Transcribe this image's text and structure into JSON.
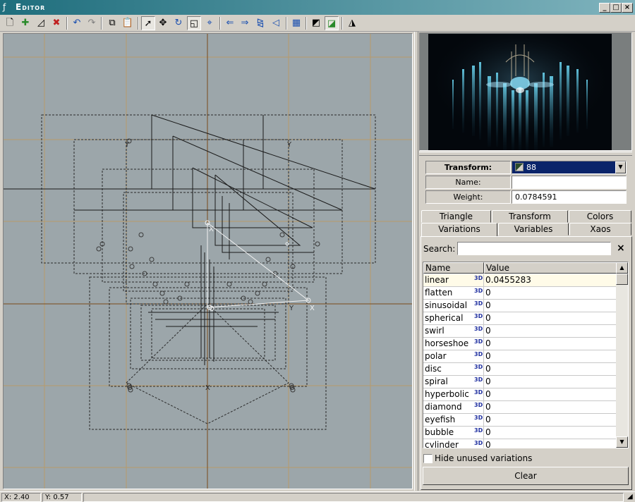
{
  "titlebar": {
    "title": "Editor",
    "minimize": "_",
    "maximize": "□",
    "close": "×"
  },
  "toolbar": {
    "icons": [
      "new-icon",
      "add-icon",
      "duplicate-icon",
      "delete-icon",
      "undo-icon",
      "redo-icon",
      "copy-icon",
      "paste-icon",
      "select-icon",
      "move-icon",
      "rotate-icon",
      "scale-icon",
      "pivot-icon",
      "rotate-left-icon",
      "rotate-right-icon",
      "flip-horizontal-icon",
      "flip-vertical-icon",
      "grid-icon",
      "toggle-variations-icon",
      "toggle-final-icon",
      "settings-icon"
    ]
  },
  "properties": {
    "transform_label": "Transform:",
    "transform_value": "88",
    "name_label": "Name:",
    "name_value": "",
    "weight_label": "Weight:",
    "weight_value": "0.0784591"
  },
  "tabs": {
    "triangle": "Triangle",
    "transform": "Transform",
    "colors": "Colors",
    "variations": "Variations",
    "variables": "Variables",
    "xaos": "Xaos"
  },
  "search": {
    "label": "Search:",
    "value": "",
    "clear": "×"
  },
  "grid": {
    "col_name": "Name",
    "col_value": "Value",
    "rows": [
      {
        "name": "linear",
        "tag": "3D",
        "value": "0.0455283"
      },
      {
        "name": "flatten",
        "tag": "3D",
        "value": "0"
      },
      {
        "name": "sinusoidal",
        "tag": "3D",
        "value": "0"
      },
      {
        "name": "spherical",
        "tag": "3D",
        "value": "0"
      },
      {
        "name": "swirl",
        "tag": "3D",
        "value": "0"
      },
      {
        "name": "horseshoe",
        "tag": "3D",
        "value": "0"
      },
      {
        "name": "polar",
        "tag": "3D",
        "value": "0"
      },
      {
        "name": "disc",
        "tag": "3D",
        "value": "0"
      },
      {
        "name": "spiral",
        "tag": "3D",
        "value": "0"
      },
      {
        "name": "hyperbolic",
        "tag": "3D",
        "value": "0"
      },
      {
        "name": "diamond",
        "tag": "3D",
        "value": "0"
      },
      {
        "name": "eyefish",
        "tag": "3D",
        "value": "0"
      },
      {
        "name": "bubble",
        "tag": "3D",
        "value": "0"
      },
      {
        "name": "cylinder",
        "tag": "3D",
        "value": "0"
      }
    ]
  },
  "hide_unused_label": "Hide unused variations",
  "clear_button": "Clear",
  "status": {
    "x": "X: 2.40",
    "y": "Y: 0.57"
  },
  "canvas_labels": {
    "axis_y": "Y",
    "axis_x": "X",
    "origin": "O"
  }
}
